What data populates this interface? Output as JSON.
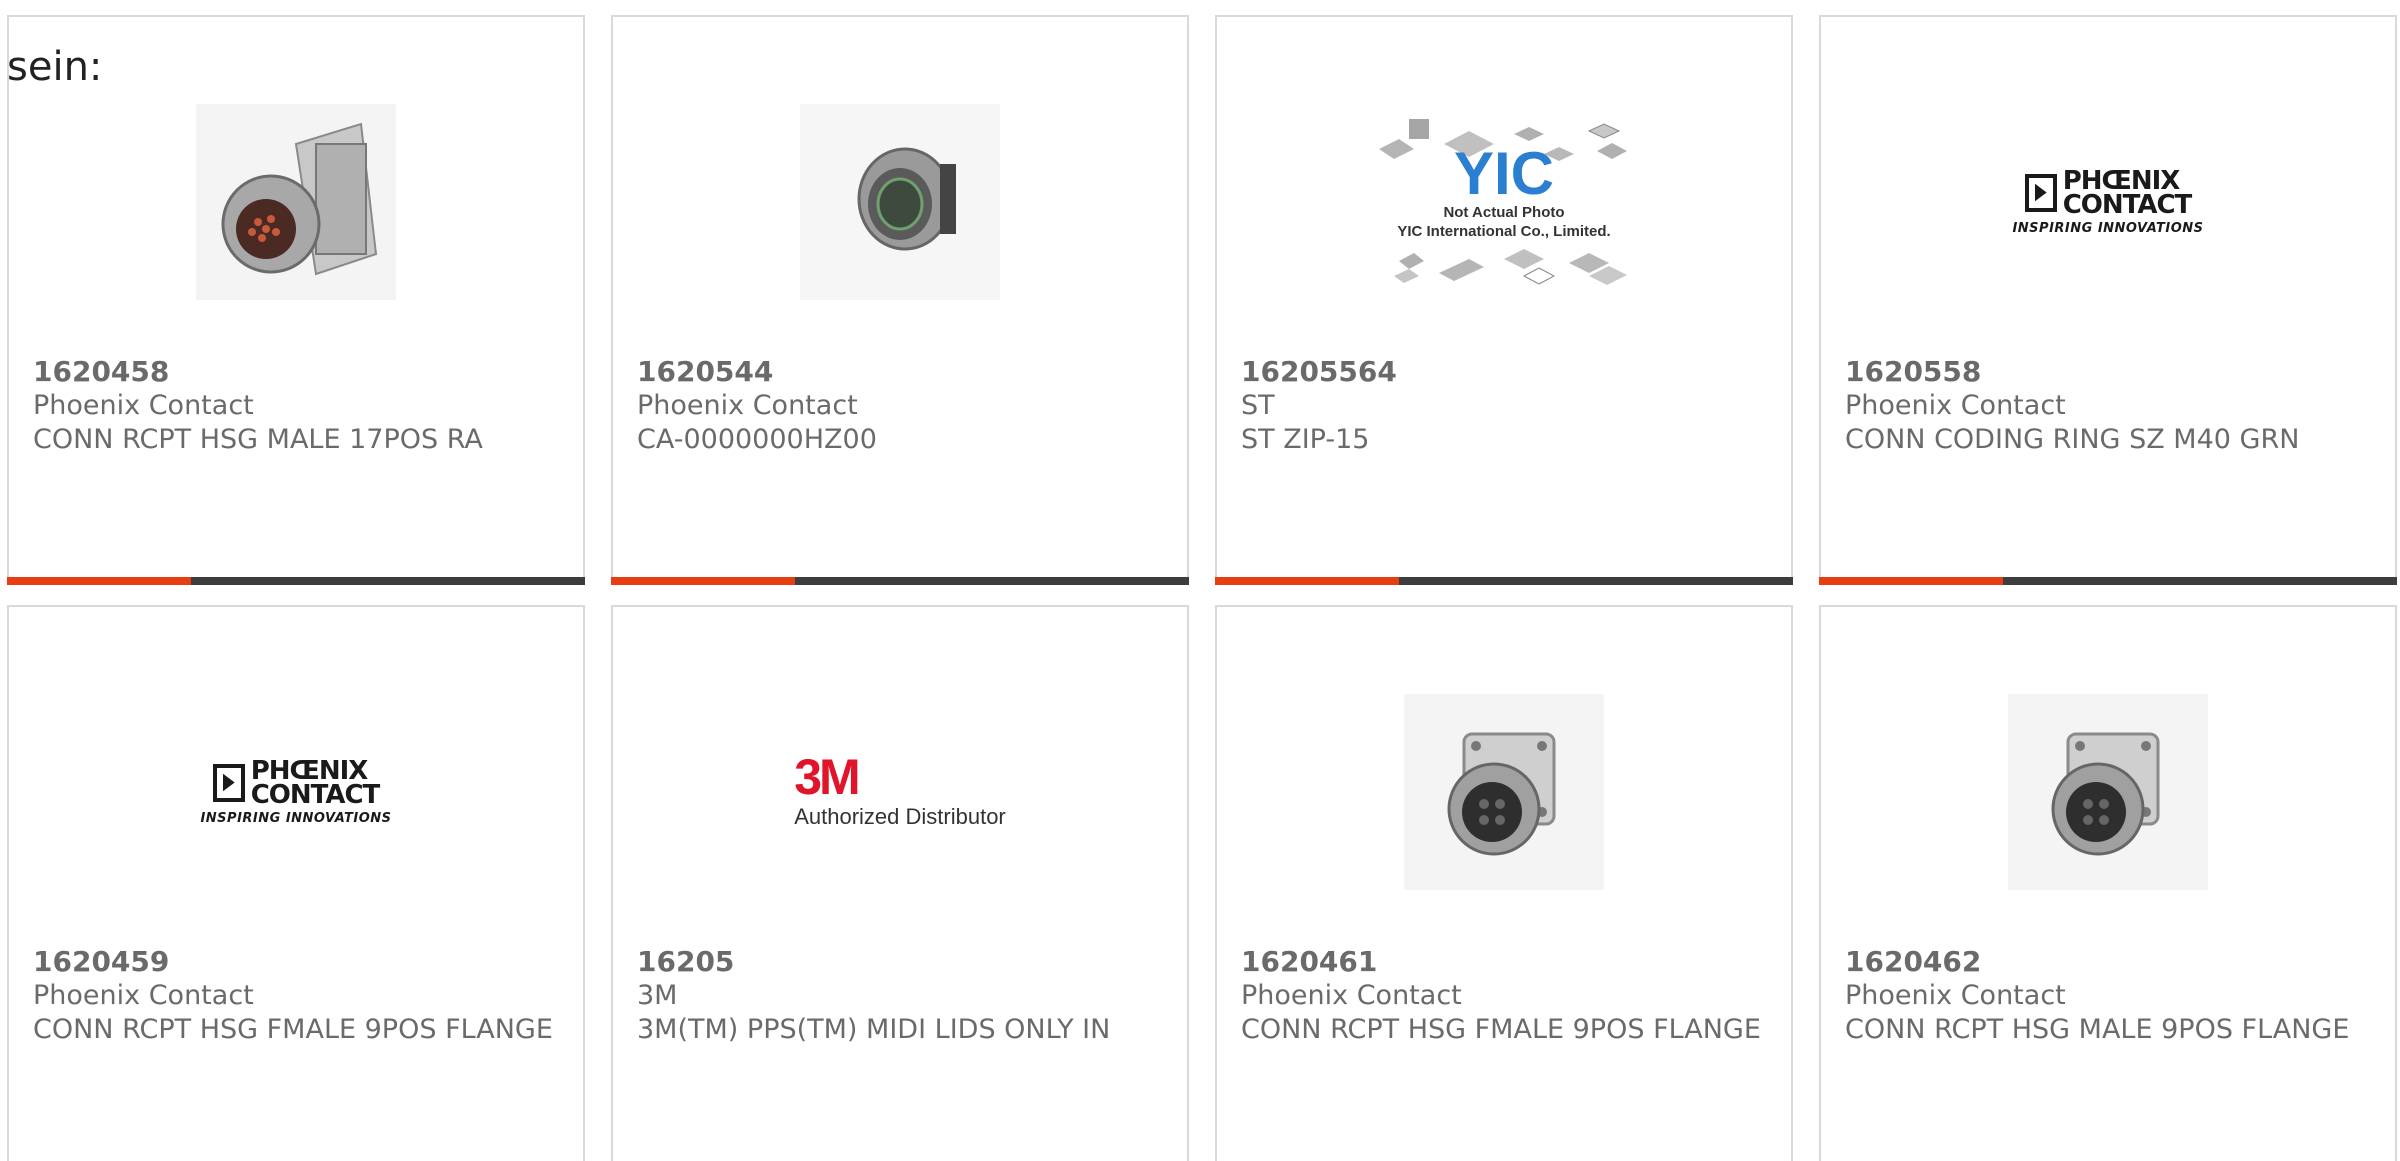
{
  "intro_text": "sein:",
  "colors": {
    "accent": "#e63d12",
    "bar": "#3d3d3d",
    "card_border": "#d9d9d9",
    "text": "#6a6a6a"
  },
  "products": [
    {
      "part_number": "1620458",
      "manufacturer": "Phoenix Contact",
      "description": "CONN RCPT HSG MALE 17POS RA",
      "image": "angled-circular-connector-photo"
    },
    {
      "part_number": "1620544",
      "manufacturer": "Phoenix Contact",
      "description": "CA-0000000HZ00",
      "image": "round-connector-photo"
    },
    {
      "part_number": "16205564",
      "manufacturer": "ST",
      "description": "ST ZIP-15",
      "image": "yic-placeholder",
      "image_text": {
        "logo": "YIC",
        "line1": "Not Actual Photo",
        "line2": "YIC International Co., Limited."
      }
    },
    {
      "part_number": "1620558",
      "manufacturer": "Phoenix Contact",
      "description": "CONN CODING RING SZ M40 GRN",
      "image": "phoenix-contact-logo",
      "image_text": {
        "line1": "PHŒNIX",
        "line2": "CONTACT",
        "tagline": "INSPIRING INNOVATIONS"
      }
    },
    {
      "part_number": "1620459",
      "manufacturer": "Phoenix Contact",
      "description": "CONN RCPT HSG FMALE 9POS FLANGE",
      "image": "phoenix-contact-logo",
      "image_text": {
        "line1": "PHŒNIX",
        "line2": "CONTACT",
        "tagline": "INSPIRING INNOVATIONS"
      }
    },
    {
      "part_number": "16205",
      "manufacturer": "3M",
      "description": "3M(TM) PPS(TM) MIDI LIDS ONLY IN",
      "image": "3m-logo",
      "image_text": {
        "logo": "3M",
        "tagline": "Authorized Distributor"
      }
    },
    {
      "part_number": "1620461",
      "manufacturer": "Phoenix Contact",
      "description": "CONN RCPT HSG FMALE 9POS FLANGE",
      "image": "flange-connector-photo"
    },
    {
      "part_number": "1620462",
      "manufacturer": "Phoenix Contact",
      "description": "CONN RCPT HSG MALE 9POS FLANGE",
      "image": "flange-connector-photo"
    }
  ]
}
